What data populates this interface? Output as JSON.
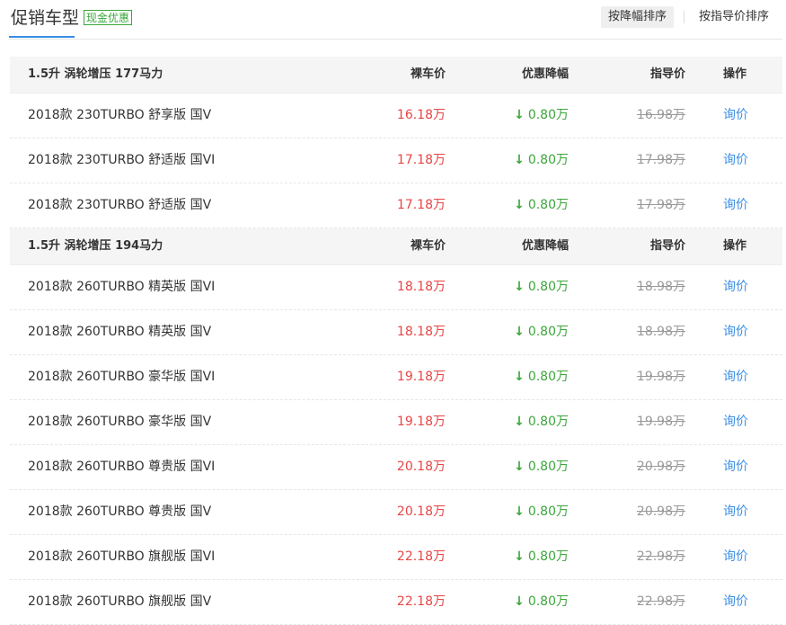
{
  "header": {
    "title": "促销车型",
    "badge": "现金优惠",
    "sort_by_discount": "按降幅排序",
    "sort_by_guide": "按指导价排序"
  },
  "columns": {
    "price": "裸车价",
    "discount": "优惠降幅",
    "guide": "指导价",
    "op": "操作"
  },
  "groups": [
    {
      "name": "1.5升 涡轮增压 177马力",
      "rows": [
        {
          "name": "2018款 230TURBO 舒享版 国V",
          "price": "16.18万",
          "discount": "0.80万",
          "guide": "16.98万",
          "op": "询价"
        },
        {
          "name": "2018款 230TURBO 舒适版 国VI",
          "price": "17.18万",
          "discount": "0.80万",
          "guide": "17.98万",
          "op": "询价"
        },
        {
          "name": "2018款 230TURBO 舒适版 国V",
          "price": "17.18万",
          "discount": "0.80万",
          "guide": "17.98万",
          "op": "询价"
        }
      ]
    },
    {
      "name": "1.5升 涡轮增压 194马力",
      "rows": [
        {
          "name": "2018款 260TURBO 精英版 国VI",
          "price": "18.18万",
          "discount": "0.80万",
          "guide": "18.98万",
          "op": "询价"
        },
        {
          "name": "2018款 260TURBO 精英版 国V",
          "price": "18.18万",
          "discount": "0.80万",
          "guide": "18.98万",
          "op": "询价"
        },
        {
          "name": "2018款 260TURBO 豪华版 国VI",
          "price": "19.18万",
          "discount": "0.80万",
          "guide": "19.98万",
          "op": "询价"
        },
        {
          "name": "2018款 260TURBO 豪华版 国V",
          "price": "19.18万",
          "discount": "0.80万",
          "guide": "19.98万",
          "op": "询价"
        },
        {
          "name": "2018款 260TURBO 尊贵版 国VI",
          "price": "20.18万",
          "discount": "0.80万",
          "guide": "20.98万",
          "op": "询价"
        },
        {
          "name": "2018款 260TURBO 尊贵版 国V",
          "price": "20.18万",
          "discount": "0.80万",
          "guide": "20.98万",
          "op": "询价"
        },
        {
          "name": "2018款 260TURBO 旗舰版 国VI",
          "price": "22.18万",
          "discount": "0.80万",
          "guide": "22.98万",
          "op": "询价"
        },
        {
          "name": "2018款 260TURBO 旗舰版 国V",
          "price": "22.18万",
          "discount": "0.80万",
          "guide": "22.98万",
          "op": "询价"
        }
      ]
    }
  ],
  "colors": {
    "accent": "#3a8ee6",
    "price": "#e84545",
    "discount": "#3ba63b",
    "muted": "#999999"
  }
}
